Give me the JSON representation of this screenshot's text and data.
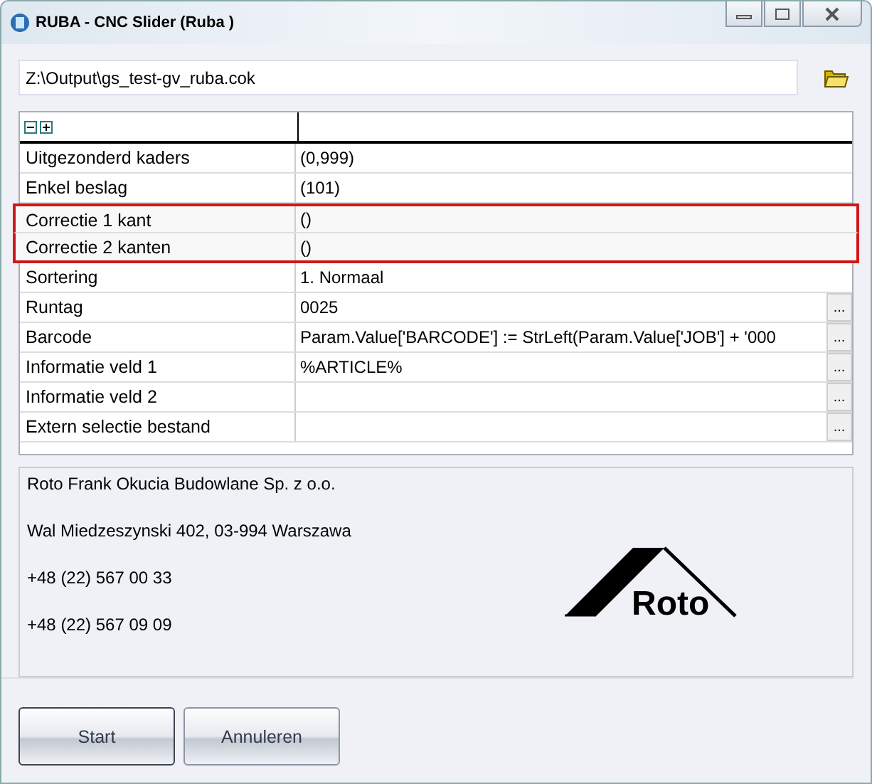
{
  "window": {
    "title": "RUBA - CNC Slider (Ruba )"
  },
  "path_field": {
    "value": "Z:\\Output\\gs_test-gv_ruba.cok"
  },
  "grid": {
    "rows": [
      {
        "label": "Uitgezonderd kaders",
        "value": "(0,999)",
        "kind": "text",
        "highlighted": false
      },
      {
        "label": "Enkel beslag",
        "value": "(101)",
        "kind": "text",
        "highlighted": false
      },
      {
        "label": "Correctie 1 kant",
        "value": "()",
        "kind": "text",
        "highlighted": true
      },
      {
        "label": "Correctie 2 kanten",
        "value": "()",
        "kind": "text",
        "highlighted": true
      },
      {
        "label": "Sortering",
        "value": "1. Normaal",
        "kind": "text",
        "highlighted": false
      },
      {
        "label": "Runtag",
        "value": "0025",
        "kind": "ellipsis",
        "highlighted": false
      },
      {
        "label": "Barcode",
        "value": "Param.Value['BARCODE'] := StrLeft(Param.Value['JOB'] + '000",
        "kind": "ellipsis",
        "highlighted": false
      },
      {
        "label": "Informatie veld 1",
        "value": "%ARTICLE%",
        "kind": "ellipsis",
        "highlighted": false
      },
      {
        "label": "Informatie veld 2",
        "value": "",
        "kind": "ellipsis",
        "highlighted": false
      },
      {
        "label": "Extern selectie bestand",
        "value": "",
        "kind": "ellipsis",
        "highlighted": false
      }
    ],
    "button_text": "..."
  },
  "info": {
    "lines": [
      "Roto Frank Okucia Budowlane Sp. z o.o.",
      "Wal Miedzeszynski 402, 03-994 Warszawa",
      "+48 (22) 567 00 33",
      "+48 (22) 567 09 09"
    ],
    "logo_text": "Roto"
  },
  "buttons": [
    "Start",
    "Annuleren"
  ]
}
